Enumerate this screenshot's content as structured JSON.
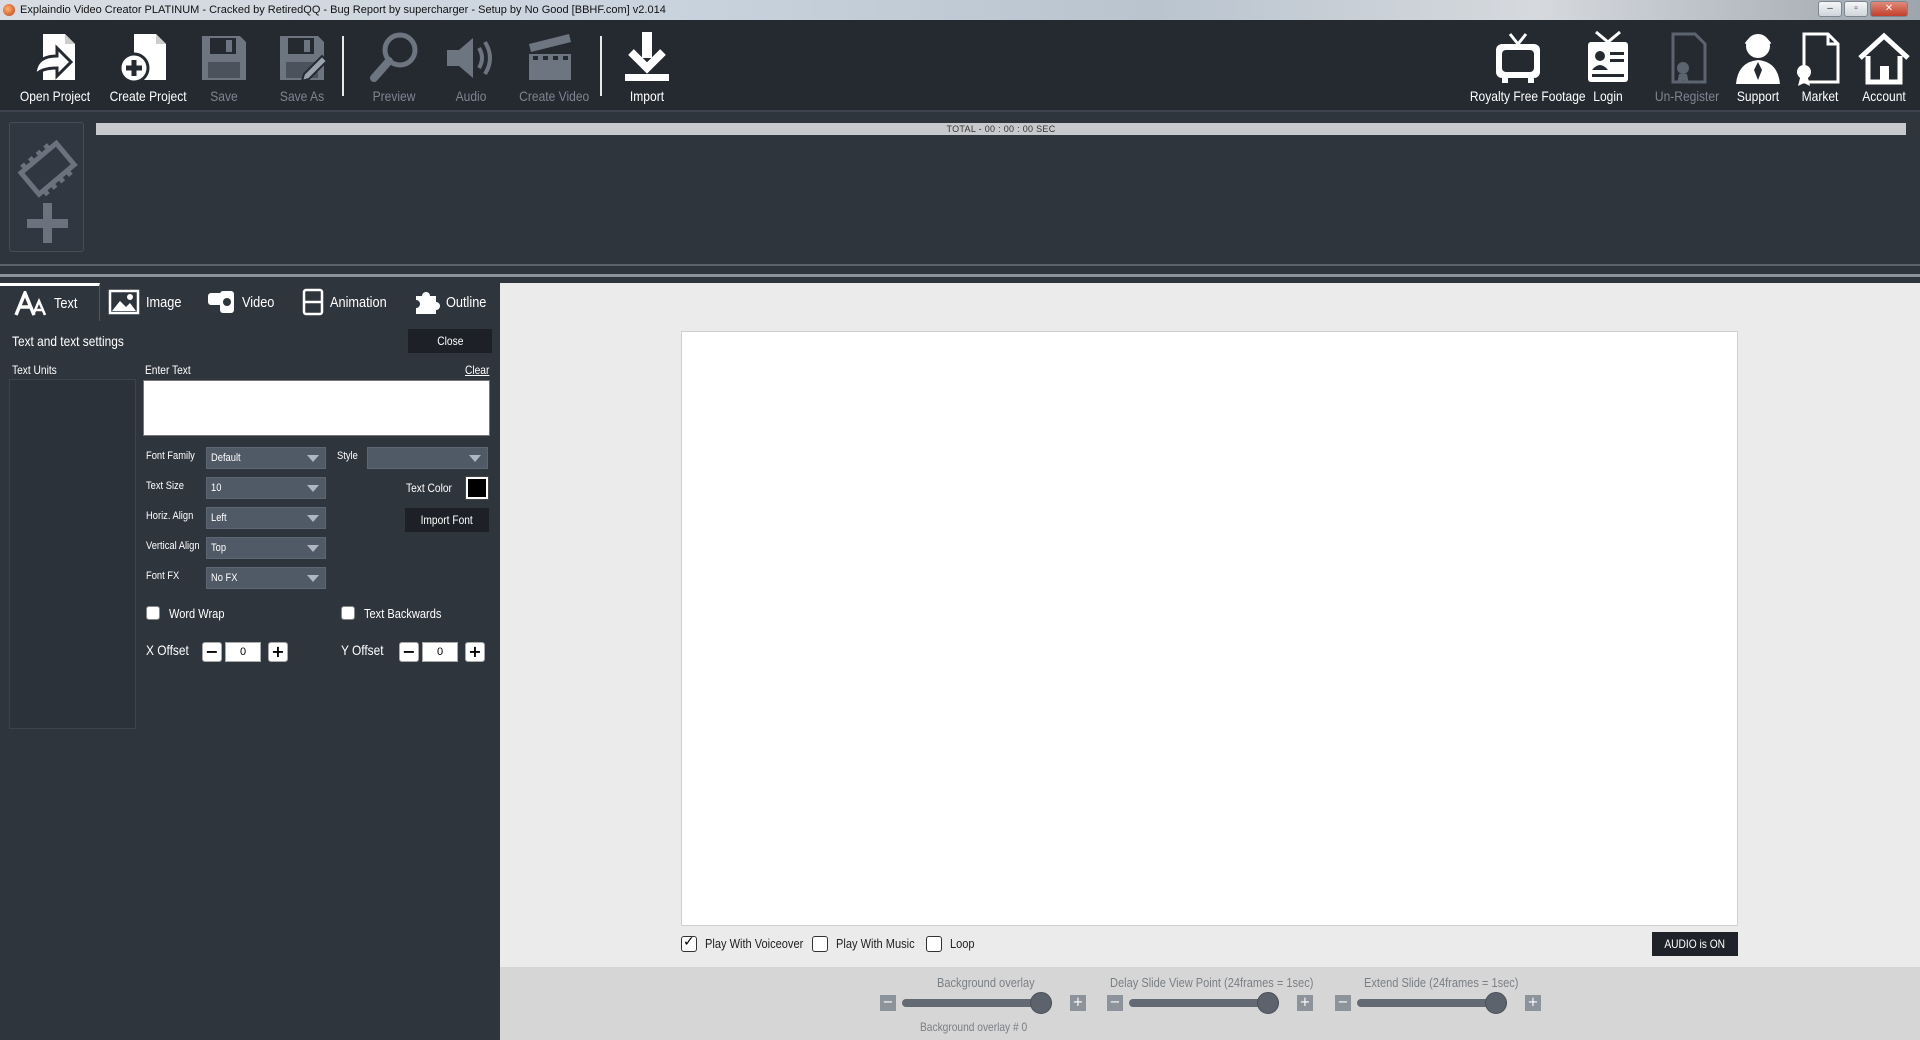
{
  "window": {
    "title": "Explaindio Video Creator PLATINUM - Cracked by RetiredQQ - Bug Report by supercharger - Setup by No Good [BBHF.com] v2.014",
    "minimize_glyph": "–",
    "restore_glyph": "▫",
    "close_glyph": "✕"
  },
  "toolbar": {
    "left": [
      {
        "label": "Open Project",
        "icon": "open-project-icon",
        "enabled": true
      },
      {
        "label": "Create Project",
        "icon": "create-project-icon",
        "enabled": true
      },
      {
        "label": "Save",
        "icon": "save-icon",
        "enabled": false
      },
      {
        "label": "Save As",
        "icon": "save-as-icon",
        "enabled": false
      },
      {
        "label": "Preview",
        "icon": "preview-icon",
        "enabled": false
      },
      {
        "label": "Audio",
        "icon": "audio-icon",
        "enabled": false
      },
      {
        "label": "Create Video",
        "icon": "clapperboard-icon",
        "enabled": false
      },
      {
        "label": "Import",
        "icon": "import-icon",
        "enabled": true
      }
    ],
    "right": [
      {
        "label": "Royalty Free Footage",
        "icon": "tv-icon",
        "enabled": true
      },
      {
        "label": "Login",
        "icon": "login-badge-icon",
        "enabled": true
      },
      {
        "label": "Un-Register",
        "icon": "unregister-icon",
        "enabled": false
      },
      {
        "label": "Support",
        "icon": "support-person-icon",
        "enabled": true
      },
      {
        "label": "Market",
        "icon": "market-icon",
        "enabled": true
      },
      {
        "label": "Account",
        "icon": "home-icon",
        "enabled": true
      }
    ]
  },
  "timeline": {
    "total_label": "TOTAL -  00 : 00 : 00 SEC"
  },
  "tabs": [
    {
      "label": "Text",
      "icon": "text-tab-icon",
      "active": true
    },
    {
      "label": "Image",
      "icon": "image-tab-icon",
      "active": false
    },
    {
      "label": "Video",
      "icon": "video-tab-icon",
      "active": false
    },
    {
      "label": "Animation",
      "icon": "animation-tab-icon",
      "active": false
    },
    {
      "label": "Outline",
      "icon": "outline-tab-icon",
      "active": false
    }
  ],
  "text_panel": {
    "heading": "Text and text settings",
    "close_label": "Close",
    "units_label": "Text Units",
    "enter_text_label": "Enter Text",
    "clear_label": "Clear",
    "enter_text_value": "",
    "font_family": {
      "label": "Font Family",
      "value": "Default"
    },
    "text_size": {
      "label": "Text Size",
      "value": "10"
    },
    "horiz_align": {
      "label": "Horiz. Align",
      "value": "Left"
    },
    "vertical_align": {
      "label": "Vertical Align",
      "value": "Top"
    },
    "font_fx": {
      "label": "Font FX",
      "value": "No FX"
    },
    "style": {
      "label": "Style",
      "value": ""
    },
    "text_color_label": "Text Color",
    "text_color": "#000000",
    "import_font_label": "Import Font",
    "word_wrap": {
      "label": "Word Wrap",
      "checked": false
    },
    "text_backwards": {
      "label": "Text Backwards",
      "checked": false
    },
    "x_offset": {
      "label": "X Offset",
      "value": "0"
    },
    "y_offset": {
      "label": "Y Offset",
      "value": "0"
    },
    "minus_glyph": "−",
    "plus_glyph": "+"
  },
  "preview": {
    "play_with_voiceover": {
      "label": "Play With Voiceover",
      "checked": true
    },
    "play_with_music": {
      "label": "Play With Music",
      "checked": false
    },
    "loop": {
      "label": "Loop",
      "checked": false
    },
    "audio_button": "AUDIO is ON"
  },
  "sliders": {
    "background_overlay": {
      "label": "Background overlay",
      "sublabel": "Background overlay  # 0",
      "value": 1.0
    },
    "delay_slide": {
      "label": "Delay Slide View Point (24frames = 1sec)",
      "value": 1.0
    },
    "extend_slide": {
      "label": "Extend Slide (24frames = 1sec)",
      "value": 1.0
    },
    "minus_glyph": "−",
    "plus_glyph": "+"
  },
  "colors": {
    "toolbar_bg": "#252a31",
    "panel_bg": "#2f353d",
    "preview_bg": "#ebebeb",
    "disabled_text": "#7d8591"
  }
}
